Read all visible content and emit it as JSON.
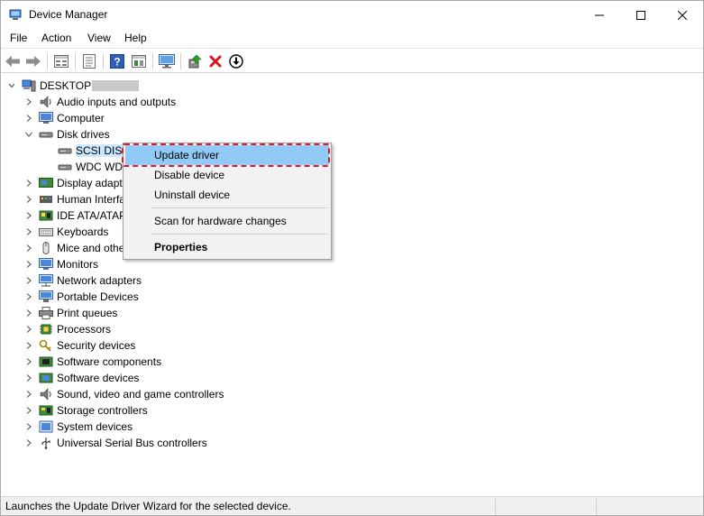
{
  "window": {
    "title": "Device Manager",
    "controls": {
      "minimize": "minimize",
      "maximize": "maximize",
      "close": "close"
    }
  },
  "menubar": {
    "items": [
      {
        "label": "File"
      },
      {
        "label": "Action"
      },
      {
        "label": "View"
      },
      {
        "label": "Help"
      }
    ]
  },
  "toolbar": {
    "buttons": [
      {
        "icon": "back-arrow-icon"
      },
      {
        "icon": "forward-arrow-icon"
      },
      {
        "icon": "properties-sheet-icon"
      },
      {
        "icon": "device-list-icon"
      },
      {
        "icon": "help-icon"
      },
      {
        "icon": "view-resources-icon"
      },
      {
        "icon": "monitor-icon"
      },
      {
        "icon": "update-driver-icon"
      },
      {
        "icon": "uninstall-x-icon"
      },
      {
        "icon": "download-circle-icon"
      }
    ]
  },
  "tree": {
    "root": {
      "label": "DESKTOP",
      "redacted": true
    },
    "categories": [
      {
        "label": "Audio inputs and outputs",
        "icon": "speaker-icon"
      },
      {
        "label": "Computer",
        "icon": "computer-icon"
      },
      {
        "label": "Disk drives",
        "icon": "disk-drive-icon",
        "expanded": true,
        "children": [
          {
            "label": "SCSI DISK",
            "icon": "disk-icon",
            "selected": true
          },
          {
            "label": "WDC WD",
            "icon": "disk-icon"
          }
        ]
      },
      {
        "label": "Display adapters",
        "icon": "display-adapter-icon"
      },
      {
        "label": "Human Interface Devices",
        "icon": "hid-icon"
      },
      {
        "label": "IDE ATA/ATAPI controllers",
        "icon": "ide-controller-icon"
      },
      {
        "label": "Keyboards",
        "icon": "keyboard-icon"
      },
      {
        "label": "Mice and other pointing devices",
        "icon": "mouse-icon"
      },
      {
        "label": "Monitors",
        "icon": "monitor-icon"
      },
      {
        "label": "Network adapters",
        "icon": "network-adapter-icon"
      },
      {
        "label": "Portable Devices",
        "icon": "portable-device-icon"
      },
      {
        "label": "Print queues",
        "icon": "printer-icon"
      },
      {
        "label": "Processors",
        "icon": "processor-icon"
      },
      {
        "label": "Security devices",
        "icon": "security-key-icon"
      },
      {
        "label": "Software components",
        "icon": "software-component-icon"
      },
      {
        "label": "Software devices",
        "icon": "software-device-icon"
      },
      {
        "label": "Sound, video and game controllers",
        "icon": "sound-icon"
      },
      {
        "label": "Storage controllers",
        "icon": "storage-controller-icon"
      },
      {
        "label": "System devices",
        "icon": "system-device-icon"
      },
      {
        "label": "Universal Serial Bus controllers",
        "icon": "usb-icon"
      }
    ]
  },
  "context_menu": {
    "items": [
      {
        "label": "Update driver",
        "highlighted": true
      },
      {
        "label": "Disable device"
      },
      {
        "label": "Uninstall device"
      },
      {
        "label": "Scan for hardware changes"
      },
      {
        "label": "Properties",
        "bold": true
      }
    ]
  },
  "statusbar": {
    "text": "Launches the Update Driver Wizard for the selected device."
  },
  "colors": {
    "selection": "#cce8ff",
    "menu_highlight": "#91c9f7",
    "annotation_red": "#e01b24",
    "menu_bg": "#f2f2f2"
  }
}
